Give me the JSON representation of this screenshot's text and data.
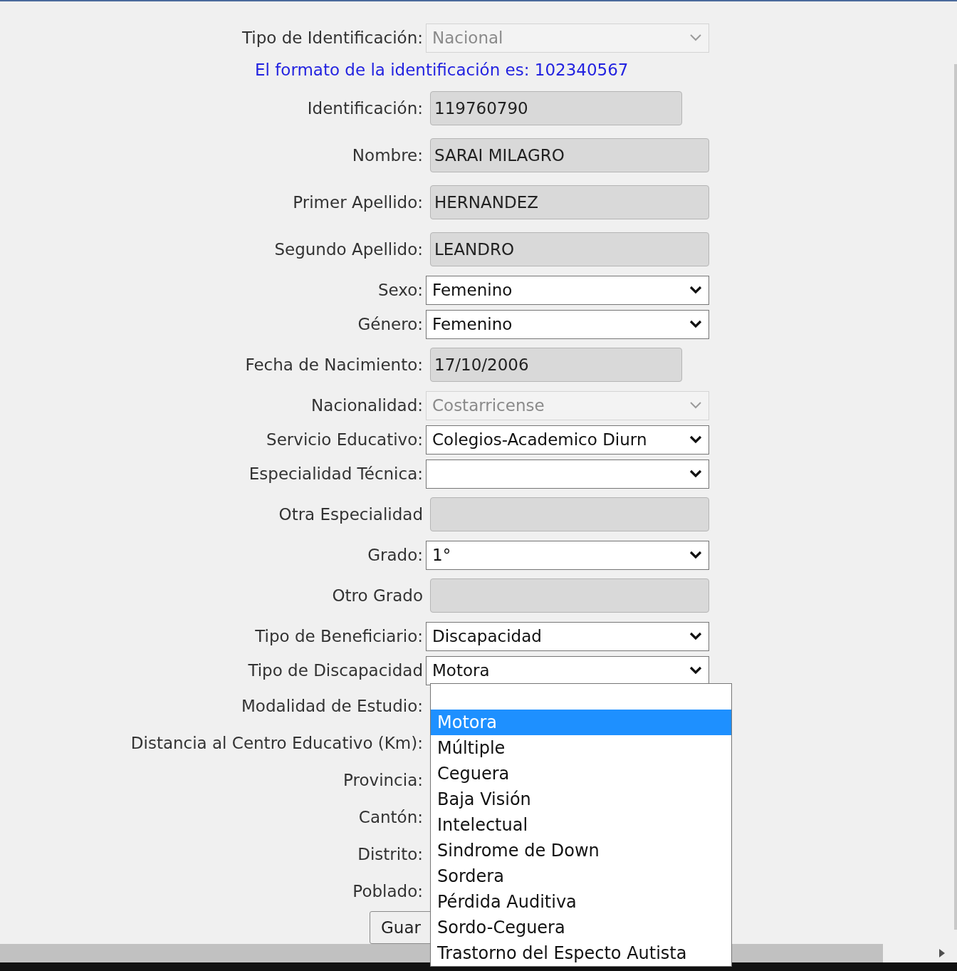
{
  "form": {
    "rows": [
      {
        "label": "Tipo de Identificación:",
        "kind": "select",
        "disabled": true,
        "value": "Nacional"
      },
      {
        "label": "Identificación:",
        "kind": "shorttext",
        "value": "119760790"
      },
      {
        "label": "Nombre:",
        "kind": "text",
        "value": "SARAI MILAGRO"
      },
      {
        "label": "Primer Apellido:",
        "kind": "text",
        "value": "HERNANDEZ"
      },
      {
        "label": "Segundo Apellido:",
        "kind": "text",
        "value": "LEANDRO"
      },
      {
        "label": "Sexo:",
        "kind": "select",
        "disabled": false,
        "value": "Femenino"
      },
      {
        "label": "Género:",
        "kind": "select",
        "disabled": false,
        "value": "Femenino"
      },
      {
        "label": "Fecha de Nacimiento:",
        "kind": "shorttext",
        "value": "17/10/2006"
      },
      {
        "label": "Nacionalidad:",
        "kind": "select",
        "disabled": true,
        "value": "Costarricense"
      },
      {
        "label": "Servicio Educativo:",
        "kind": "select",
        "disabled": false,
        "value": "Colegios-Academico Diurn"
      },
      {
        "label": "Especialidad Técnica:",
        "kind": "select",
        "disabled": false
      },
      {
        "label": "Otra Especialidad",
        "kind": "text"
      },
      {
        "label": "Grado:",
        "kind": "select",
        "disabled": false,
        "value": "1°"
      },
      {
        "label": "Otro Grado",
        "kind": "text"
      },
      {
        "label": "Tipo de Beneficiario:",
        "kind": "select",
        "disabled": false,
        "value": "Discapacidad"
      },
      {
        "label": "Tipo de Discapacidad",
        "kind": "select",
        "disabled": false,
        "value": "Motora"
      },
      {
        "label": "Modalidad de Estudio:",
        "kind": "label"
      },
      {
        "label": "Distancia al Centro Educativo (Km):",
        "kind": "label"
      },
      {
        "label": "Provincia:",
        "kind": "label"
      },
      {
        "label": "Cantón:",
        "kind": "label"
      },
      {
        "label": "Distrito:",
        "kind": "label"
      },
      {
        "label": "Poblado:",
        "kind": "label"
      }
    ],
    "format_note": "El formato de la identificación es: 102340567",
    "save_button": "Guar"
  },
  "dropdown": {
    "options": [
      {
        "label": "Motora",
        "selected": true
      },
      {
        "label": "Múltiple",
        "selected": false
      },
      {
        "label": "Ceguera",
        "selected": false
      },
      {
        "label": "Baja Visión",
        "selected": false
      },
      {
        "label": "Intelectual",
        "selected": false
      },
      {
        "label": "Sindrome de Down",
        "selected": false
      },
      {
        "label": "Sordera",
        "selected": false
      },
      {
        "label": "Pérdida Auditiva",
        "selected": false
      },
      {
        "label": "Sordo-Ceguera",
        "selected": false
      },
      {
        "label": "Trastorno del Especto Autista",
        "selected": false
      }
    ]
  }
}
